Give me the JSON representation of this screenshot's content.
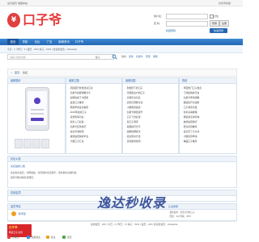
{
  "topbar": {
    "left_links": [
      "设为首页",
      "收藏本站"
    ],
    "right_link": "访问手机版"
  },
  "logo": {
    "mark": "¥",
    "mark_small": "Y",
    "text": "口子爷"
  },
  "login": {
    "username_label": "用户名：",
    "password_label": "密  码：",
    "remember_label": "记住",
    "login_button": "登录",
    "register_button": "注册",
    "forgot_link": "找回密码",
    "quick_login_button": "快速登录"
  },
  "nav": {
    "items": [
      "首页",
      "导航",
      "论坛",
      "广告",
      "新闻资讯",
      "口子爷"
    ],
    "active_index": 0
  },
  "subnav": {
    "text": "今日：0 | 昨日：0 | 会员：249 | 帖子：5231 | 欢迎新会员：oliviaquba"
  },
  "search": {
    "placeholder": "请输入搜索内容",
    "scope": "帖子",
    "hot_label": "热搜：",
    "hot_items": [
      "贷款",
      "信用卡",
      "花呗",
      "借呗"
    ]
  },
  "breadcrumb": {
    "home": "首页",
    "current": "论坛"
  },
  "sections": [
    {
      "title": "最新图片"
    },
    {
      "title": "最新主题",
      "items": [
        "· 招商银行优惠活动汇总",
        "· 信用卡提额攻略分享",
        "· 如何快速下卡经验",
        "· 最新口子推荐",
        "· 网贷申请注意事项",
        "· 2023年最新口子",
        "· 贷款利率对比",
        "· 新手入门必看",
        "· 信用卡还款技巧",
        "· 征信查询指南",
        "· 放款速度快的平台",
        "· 大额口子汇总"
      ]
    },
    {
      "title": "最新回复",
      "items": [
        "· 秒批秒下款口子",
        "· 无视黑白户的口子",
        "· 分期平台对比",
        "· 还款日调整方法",
        "· 小额借款渠道",
        "· 信用卡额度提升",
        "· 口子下款反馈",
        "· 新口子测评",
        "· 提额技巧分享",
        "· 逾期处理建议",
        "· 征信修复方法",
        "· 贷款避坑指南"
      ]
    },
    {
      "title": "热帖",
      "items": [
        "· 年度热门口子盘点",
        "· 下款最快的平台",
        "· 信用卡申请攻略",
        "· 额度提升全指南",
        "· 口子测评合集",
        "· 新手必看教程",
        "· 网贷黑名单查询",
        "· 放款速度排行",
        "· 低息贷款推荐",
        "· 征信花了怎么办",
        "· 大额贷款申请",
        "· 精品口子推荐"
      ]
    }
  ],
  "announcement": {
    "title": "论坛公告",
    "subtitle": "论坛最新公告",
    "lines": [
      "欢迎各位会员，文明发帖，共同维护论坛秩序，请勿发布违规内容。",
      "如有问题请联系管理员。"
    ]
  },
  "online": {
    "title": "在线会员"
  },
  "groups": {
    "title": "会员专区",
    "item_label": "新手区",
    "right_title": "认证商家",
    "right_lines": [
      "· 最新发布：某某平台新口子",
      "· 回复：123 查看：4567"
    ]
  },
  "stats_bar": {
    "text": "在线会员：2(0) | 今日：0 | 昨日：0 | 帖子：5231 | 会员：249 | 欢迎新会员：oliviaquba"
  },
  "footer_ad": {
    "line1": "口子爷",
    "line2": "网贷口子交流"
  },
  "legend": {
    "items": [
      "管理员",
      "超级版主",
      "版主",
      "会员"
    ],
    "colors": [
      "#e04040",
      "#3a89d6",
      "#f0a020",
      "#52a352"
    ]
  },
  "watermark": "逸达秒收录",
  "colors": {
    "brand": "#e63b3b",
    "nav": "#2568b3",
    "panel_header": "#eef3f9",
    "watermark": "#1e3b8c"
  }
}
